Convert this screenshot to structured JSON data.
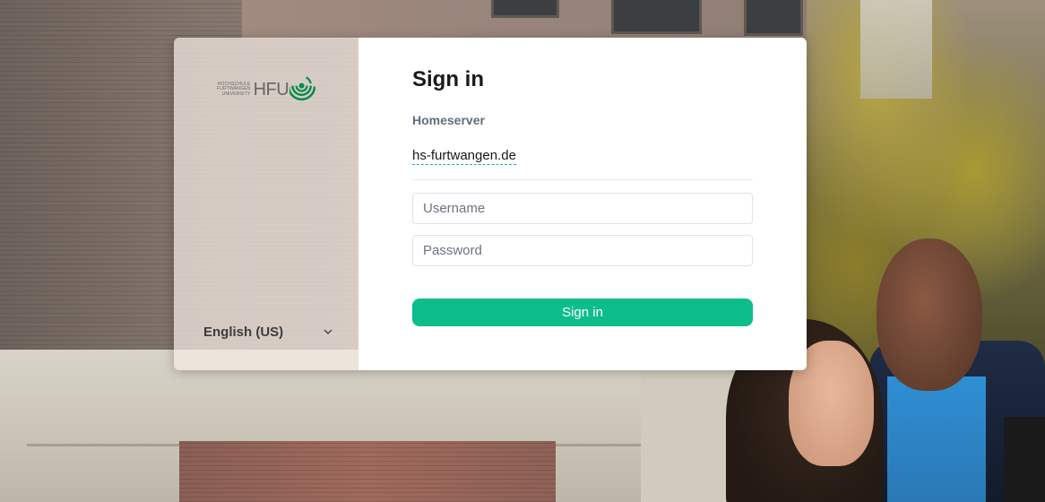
{
  "brand": {
    "logo_small_lines": [
      "HOCHSCHULE",
      "FURTWANGEN",
      "UNIVERSITY"
    ],
    "logo_text": "HFU",
    "logo_color": "#008c4a"
  },
  "language": {
    "selected": "English (US)"
  },
  "login": {
    "title": "Sign in",
    "homeserver_label": "Homeserver",
    "homeserver_value": "hs-furtwangen.de",
    "username_placeholder": "Username",
    "password_placeholder": "Password",
    "submit_label": "Sign in"
  },
  "colors": {
    "accent": "#0dbd8b",
    "text": "#17191c",
    "muted": "#636c7d"
  }
}
